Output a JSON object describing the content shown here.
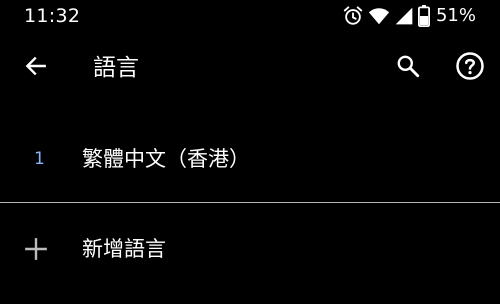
{
  "status_bar": {
    "time": "11:32",
    "battery_percent": "51%",
    "icons": [
      "alarm-icon",
      "wifi-icon",
      "signal-icon",
      "battery-icon"
    ]
  },
  "app_bar": {
    "title": "語言",
    "icons": [
      "back-arrow-icon",
      "search-icon",
      "help-icon"
    ]
  },
  "languages": [
    {
      "index": "1",
      "name": "繁體中文（香港）"
    }
  ],
  "add_language": {
    "label": "新增語言",
    "icon": "plus-icon"
  },
  "colors": {
    "background": "#000000",
    "text": "#ffffff",
    "accent": "#8ab4f8",
    "divider": "#b5b5b5"
  }
}
